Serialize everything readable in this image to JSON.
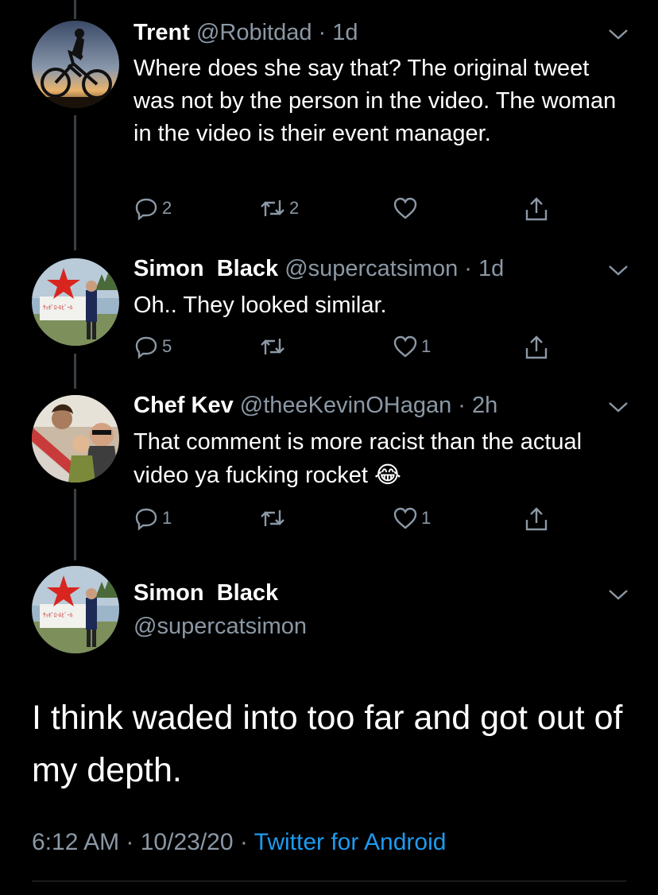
{
  "tweets": [
    {
      "name": "Trent",
      "handle": "@Robitdad",
      "sep": " · ",
      "time": "1d",
      "text": "Where does she say that? The original tweet was not by the person in the video. The woman in the video is their event manager.",
      "replies": "2",
      "retweets": "2",
      "likes": ""
    },
    {
      "name": "Simon  Black",
      "handle": "@supercatsimon",
      "sep": " · ",
      "time": "1d",
      "text": "Oh.. They looked similar.",
      "replies": "5",
      "retweets": "",
      "likes": "1"
    },
    {
      "name": "Chef Kev",
      "handle": "@theeKevinOHagan",
      "sep": " · ",
      "time": "2h",
      "text": "That comment is more racist than the actual video ya fucking rocket",
      "emoji": "😂",
      "replies": "1",
      "retweets": "",
      "likes": "1"
    }
  ],
  "main_tweet": {
    "name": "Simon  Black",
    "handle": "@supercatsimon",
    "text": "I think waded into too far and got out of my depth.",
    "time": "6:12 AM",
    "sep1": " · ",
    "date": "10/23/20",
    "sep2": " · ",
    "source": "Twitter for Android"
  },
  "colors": {
    "background": "#000000",
    "secondary_text": "#8b98a5",
    "link": "#1d9bf0",
    "thread_line": "#3a3f44"
  }
}
